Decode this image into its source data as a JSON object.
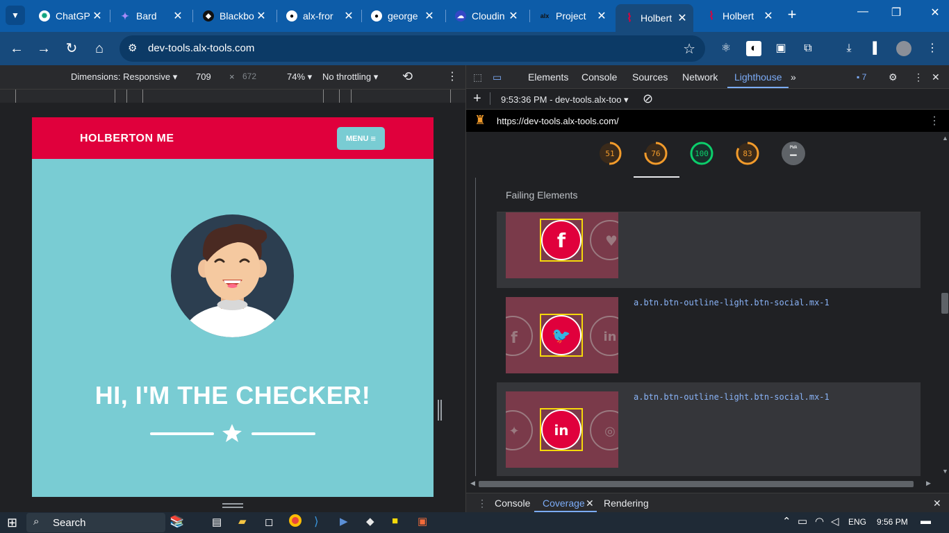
{
  "browser": {
    "tabs": [
      {
        "title": "ChatGP",
        "icon": "chatgpt-icon"
      },
      {
        "title": "Bard",
        "icon": "bard-icon"
      },
      {
        "title": "Blackbo",
        "icon": "blackbox-icon"
      },
      {
        "title": "alx-fror",
        "icon": "github-icon"
      },
      {
        "title": "george",
        "icon": "github-icon"
      },
      {
        "title": "Cloudin",
        "icon": "cloudinary-icon"
      },
      {
        "title": "Project",
        "icon": "alx-icon"
      },
      {
        "title": "Holbert",
        "icon": "holberton-icon",
        "active": true
      },
      {
        "title": "Holbert",
        "icon": "holberton-icon"
      }
    ],
    "url": "dev-tools.alx-tools.com"
  },
  "device_toolbar": {
    "dimensions_label": "Dimensions: Responsive",
    "width": "709",
    "times": "×",
    "height": "672",
    "zoom": "74%",
    "throttling": "No throttling"
  },
  "site": {
    "brand": "HOLBERTON ME",
    "menu_label": "MENU",
    "menu_icon": "≡",
    "hero_title": "HI, I'M THE CHECKER!"
  },
  "devtools": {
    "tabs": [
      "Elements",
      "Console",
      "Sources",
      "Network",
      "Lighthouse"
    ],
    "active_tab": "Lighthouse",
    "issues_count": "7",
    "report_label": "9:53:36 PM - dev-tools.alx-too",
    "audited_url": "https://dev-tools.alx-tools.com/",
    "scores": [
      {
        "value": "51",
        "color": "#f29b2b",
        "fraction": 0.51
      },
      {
        "value": "76",
        "color": "#f29b2b",
        "fraction": 0.76
      },
      {
        "value": "100",
        "color": "#0cce6b",
        "fraction": 1.0
      },
      {
        "value": "83",
        "color": "#f29b2b",
        "fraction": 0.83
      }
    ],
    "pwa_label": "PWA",
    "pwa_value": "–",
    "failing_header": "Failing Elements",
    "failing_rows": [
      {
        "selector": "",
        "icon": "facebook-icon"
      },
      {
        "selector": "a.btn.btn-outline-light.btn-social.mx-1",
        "icon": "twitter-icon"
      },
      {
        "selector": "a.btn.btn-outline-light.btn-social.mx-1",
        "icon": "linkedin-icon"
      }
    ],
    "drawer_tabs": [
      "Console",
      "Coverage",
      "Rendering"
    ],
    "active_drawer_tab": "Coverage"
  },
  "taskbar": {
    "search_label": "Search",
    "lang": "ENG",
    "time": "9:56 PM"
  }
}
